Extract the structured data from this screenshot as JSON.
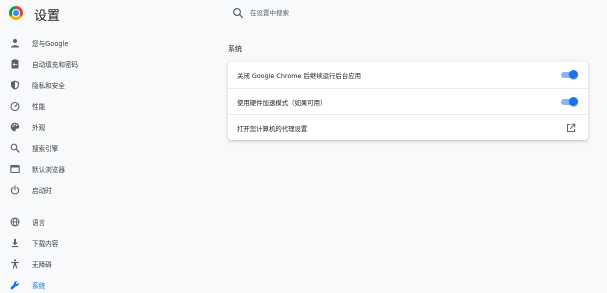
{
  "header": {
    "title": "设置",
    "logo_icon": "chrome-logo-icon"
  },
  "search": {
    "placeholder": "在设置中搜索",
    "icon": "search-icon"
  },
  "sidebar": {
    "items": [
      {
        "label": "您与Google",
        "icon": "person-icon"
      },
      {
        "label": "自动填充和密码",
        "icon": "clipboard-key-icon"
      },
      {
        "label": "隐私和安全",
        "icon": "shield-icon"
      },
      {
        "label": "性能",
        "icon": "speedometer-icon"
      },
      {
        "label": "外观",
        "icon": "palette-icon"
      },
      {
        "label": "搜索引擎",
        "icon": "search-icon"
      },
      {
        "label": "默认浏览器",
        "icon": "browser-window-icon"
      },
      {
        "label": "启动时",
        "icon": "power-icon"
      },
      {
        "label": "语言",
        "icon": "globe-icon"
      },
      {
        "label": "下载内容",
        "icon": "download-icon"
      },
      {
        "label": "无障碍",
        "icon": "accessibility-icon"
      },
      {
        "label": "系统",
        "icon": "wrench-icon",
        "active": true
      }
    ]
  },
  "main": {
    "section_title": "系统",
    "rows": [
      {
        "label": "关闭 Google Chrome 后继续运行后台应用",
        "control": "toggle",
        "on": true
      },
      {
        "label": "使用硬件加速模式（如果可用）",
        "control": "toggle",
        "on": true
      },
      {
        "label": "打开您计算机的代理设置",
        "control": "external-link-icon"
      }
    ]
  },
  "colors": {
    "accent": "#1a73e8",
    "toggle_track": "#8ab4f8",
    "background": "#f8f9fa",
    "card": "#ffffff"
  }
}
